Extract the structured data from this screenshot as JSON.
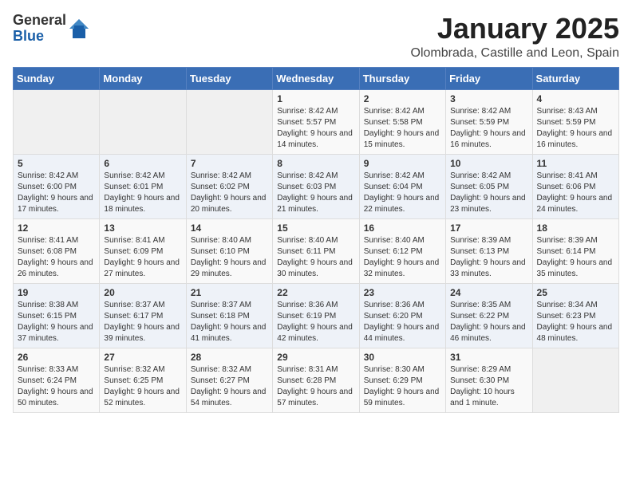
{
  "logo": {
    "general": "General",
    "blue": "Blue"
  },
  "header": {
    "month": "January 2025",
    "location": "Olombrada, Castille and Leon, Spain"
  },
  "days": [
    "Sunday",
    "Monday",
    "Tuesday",
    "Wednesday",
    "Thursday",
    "Friday",
    "Saturday"
  ],
  "weeks": [
    [
      {
        "day": "",
        "info": ""
      },
      {
        "day": "",
        "info": ""
      },
      {
        "day": "",
        "info": ""
      },
      {
        "day": "1",
        "info": "Sunrise: 8:42 AM\nSunset: 5:57 PM\nDaylight: 9 hours and 14 minutes."
      },
      {
        "day": "2",
        "info": "Sunrise: 8:42 AM\nSunset: 5:58 PM\nDaylight: 9 hours and 15 minutes."
      },
      {
        "day": "3",
        "info": "Sunrise: 8:42 AM\nSunset: 5:59 PM\nDaylight: 9 hours and 16 minutes."
      },
      {
        "day": "4",
        "info": "Sunrise: 8:43 AM\nSunset: 5:59 PM\nDaylight: 9 hours and 16 minutes."
      }
    ],
    [
      {
        "day": "5",
        "info": "Sunrise: 8:42 AM\nSunset: 6:00 PM\nDaylight: 9 hours and 17 minutes."
      },
      {
        "day": "6",
        "info": "Sunrise: 8:42 AM\nSunset: 6:01 PM\nDaylight: 9 hours and 18 minutes."
      },
      {
        "day": "7",
        "info": "Sunrise: 8:42 AM\nSunset: 6:02 PM\nDaylight: 9 hours and 20 minutes."
      },
      {
        "day": "8",
        "info": "Sunrise: 8:42 AM\nSunset: 6:03 PM\nDaylight: 9 hours and 21 minutes."
      },
      {
        "day": "9",
        "info": "Sunrise: 8:42 AM\nSunset: 6:04 PM\nDaylight: 9 hours and 22 minutes."
      },
      {
        "day": "10",
        "info": "Sunrise: 8:42 AM\nSunset: 6:05 PM\nDaylight: 9 hours and 23 minutes."
      },
      {
        "day": "11",
        "info": "Sunrise: 8:41 AM\nSunset: 6:06 PM\nDaylight: 9 hours and 24 minutes."
      }
    ],
    [
      {
        "day": "12",
        "info": "Sunrise: 8:41 AM\nSunset: 6:08 PM\nDaylight: 9 hours and 26 minutes."
      },
      {
        "day": "13",
        "info": "Sunrise: 8:41 AM\nSunset: 6:09 PM\nDaylight: 9 hours and 27 minutes."
      },
      {
        "day": "14",
        "info": "Sunrise: 8:40 AM\nSunset: 6:10 PM\nDaylight: 9 hours and 29 minutes."
      },
      {
        "day": "15",
        "info": "Sunrise: 8:40 AM\nSunset: 6:11 PM\nDaylight: 9 hours and 30 minutes."
      },
      {
        "day": "16",
        "info": "Sunrise: 8:40 AM\nSunset: 6:12 PM\nDaylight: 9 hours and 32 minutes."
      },
      {
        "day": "17",
        "info": "Sunrise: 8:39 AM\nSunset: 6:13 PM\nDaylight: 9 hours and 33 minutes."
      },
      {
        "day": "18",
        "info": "Sunrise: 8:39 AM\nSunset: 6:14 PM\nDaylight: 9 hours and 35 minutes."
      }
    ],
    [
      {
        "day": "19",
        "info": "Sunrise: 8:38 AM\nSunset: 6:15 PM\nDaylight: 9 hours and 37 minutes."
      },
      {
        "day": "20",
        "info": "Sunrise: 8:37 AM\nSunset: 6:17 PM\nDaylight: 9 hours and 39 minutes."
      },
      {
        "day": "21",
        "info": "Sunrise: 8:37 AM\nSunset: 6:18 PM\nDaylight: 9 hours and 41 minutes."
      },
      {
        "day": "22",
        "info": "Sunrise: 8:36 AM\nSunset: 6:19 PM\nDaylight: 9 hours and 42 minutes."
      },
      {
        "day": "23",
        "info": "Sunrise: 8:36 AM\nSunset: 6:20 PM\nDaylight: 9 hours and 44 minutes."
      },
      {
        "day": "24",
        "info": "Sunrise: 8:35 AM\nSunset: 6:22 PM\nDaylight: 9 hours and 46 minutes."
      },
      {
        "day": "25",
        "info": "Sunrise: 8:34 AM\nSunset: 6:23 PM\nDaylight: 9 hours and 48 minutes."
      }
    ],
    [
      {
        "day": "26",
        "info": "Sunrise: 8:33 AM\nSunset: 6:24 PM\nDaylight: 9 hours and 50 minutes."
      },
      {
        "day": "27",
        "info": "Sunrise: 8:32 AM\nSunset: 6:25 PM\nDaylight: 9 hours and 52 minutes."
      },
      {
        "day": "28",
        "info": "Sunrise: 8:32 AM\nSunset: 6:27 PM\nDaylight: 9 hours and 54 minutes."
      },
      {
        "day": "29",
        "info": "Sunrise: 8:31 AM\nSunset: 6:28 PM\nDaylight: 9 hours and 57 minutes."
      },
      {
        "day": "30",
        "info": "Sunrise: 8:30 AM\nSunset: 6:29 PM\nDaylight: 9 hours and 59 minutes."
      },
      {
        "day": "31",
        "info": "Sunrise: 8:29 AM\nSunset: 6:30 PM\nDaylight: 10 hours and 1 minute."
      },
      {
        "day": "",
        "info": ""
      }
    ]
  ]
}
